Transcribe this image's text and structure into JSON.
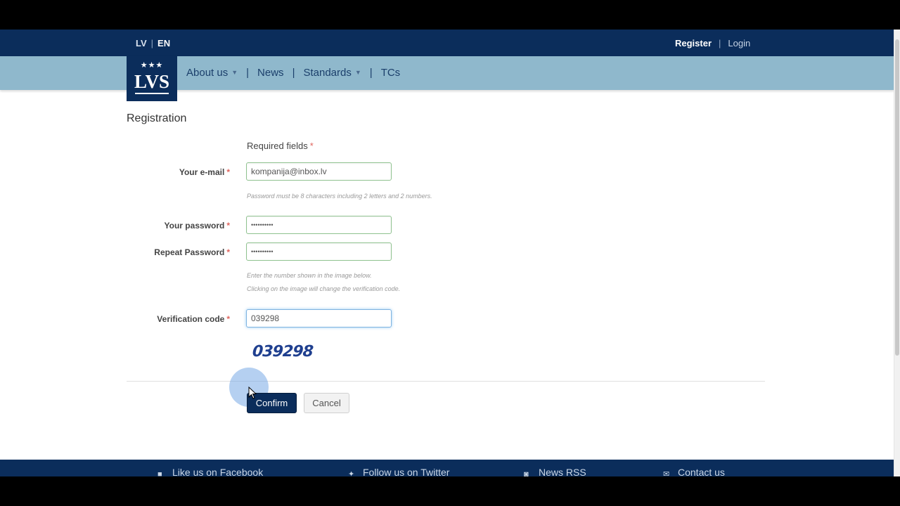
{
  "topbar": {
    "lang_lv": "LV",
    "lang_en": "EN",
    "register": "Register",
    "login": "Login"
  },
  "logo": {
    "text": "LVS",
    "stars": "★★★"
  },
  "nav": {
    "items": [
      {
        "label": "About us",
        "dropdown": true
      },
      {
        "label": "News",
        "dropdown": false
      },
      {
        "label": "Standards",
        "dropdown": true
      },
      {
        "label": "TCs",
        "dropdown": false
      }
    ]
  },
  "page": {
    "title": "Registration"
  },
  "form": {
    "required_note": "Required fields",
    "required_mark": "*",
    "email_label": "Your e-mail",
    "email_value": "kompanija@inbox.lv",
    "password_help": "Password must be 8 characters including 2 letters and 2 numbers.",
    "password_label": "Your password",
    "password_value": "••••••••••",
    "repeat_label": "Repeat Password",
    "repeat_value": "••••••••••",
    "verification_help_1": "Enter the number shown in the image below.",
    "verification_help_2": "Clicking on the image will change the verification code.",
    "verification_label": "Verification code",
    "verification_value": "039298",
    "captcha_text": "039298",
    "confirm_label": "Confirm",
    "cancel_label": "Cancel"
  },
  "footer": {
    "facebook": "Like us on Facebook",
    "twitter": "Follow us on Twitter",
    "rss": "News RSS",
    "contact": "Contact us"
  },
  "colors": {
    "brand_navy": "#0b2d5b",
    "nav_blue": "#8fb8cc",
    "required_red": "#e0665f",
    "field_border_green": "#8fc28f"
  }
}
